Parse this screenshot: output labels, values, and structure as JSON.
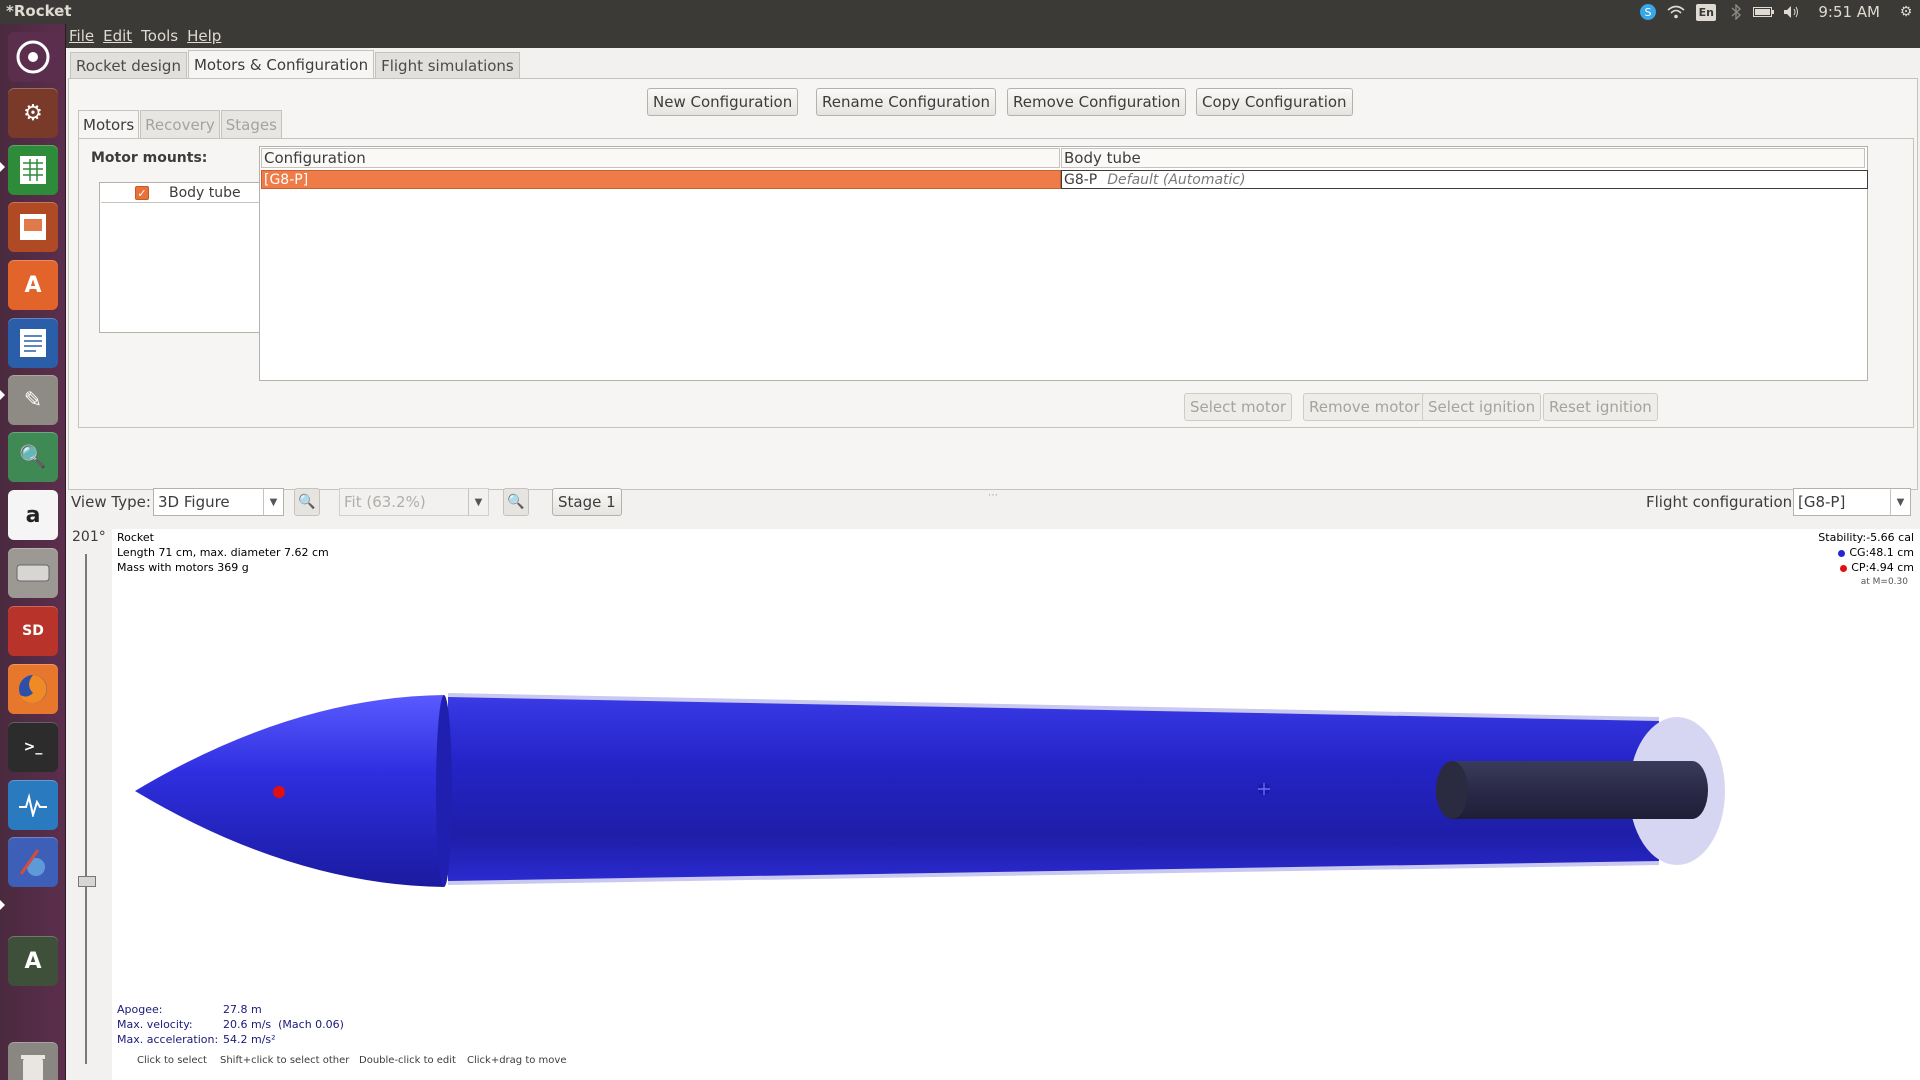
{
  "window": {
    "title": "*Rocket"
  },
  "tray": {
    "language": "En",
    "clock": "9:51 AM"
  },
  "menu": {
    "file": "File",
    "edit": "Edit",
    "tools": "Tools",
    "help": "Help"
  },
  "tabs": {
    "rocket_design": "Rocket design",
    "motors_config": "Motors & Configuration",
    "flight_sims": "Flight simulations"
  },
  "config_buttons": {
    "new": "New Configuration",
    "rename": "Rename Configuration",
    "remove": "Remove Configuration",
    "copy": "Copy Configuration"
  },
  "sub_tabs": {
    "motors": "Motors",
    "recovery": "Recovery",
    "stages": "Stages"
  },
  "motor_mounts": {
    "label": "Motor mounts:",
    "items": [
      {
        "name": "Body tube",
        "checked": true
      }
    ]
  },
  "table": {
    "headers": [
      "Configuration",
      "Body tube"
    ],
    "rows": [
      {
        "config": "[G8-P]",
        "motor": "G8-P",
        "delay": "Default (Automatic)"
      }
    ]
  },
  "motor_buttons": {
    "select_motor": "Select motor",
    "remove_motor": "Remove motor",
    "select_ignition": "Select ignition",
    "reset_ignition": "Reset ignition"
  },
  "view_toolbar": {
    "view_type_label": "View Type:",
    "view_type_value": "3D Figure",
    "zoom_value": "Fit (63.2%)",
    "stage_button": "Stage 1",
    "flight_config_label": "Flight configuration:",
    "flight_config_value": "[G8-P]"
  },
  "view": {
    "angle": "201°",
    "rocket_name": "Rocket",
    "dimensions": "Length 71 cm, max. diameter 7.62 cm",
    "mass": "Mass with motors 369 g",
    "stability": "Stability:-5.66 cal",
    "cg": "CG:48.1 cm",
    "cp": "CP:4.94 cm",
    "mach": "at M=0.30",
    "apogee_label": "Apogee:",
    "apogee_value": "27.8 m",
    "velocity_label": "Max. velocity:",
    "velocity_value": "20.6 m/s  (Mach 0.06)",
    "accel_label": "Max. acceleration:",
    "accel_value": "54.2 m/s²",
    "hints": [
      "Click to select",
      "Shift+click to select other",
      "Double-click to edit",
      "Click+drag to move"
    ]
  },
  "colors": {
    "selection": "#ee7b48",
    "rocket_body": "#2424d8",
    "launcher_bg": "#5c2e4d"
  },
  "launcher_icons": [
    "ubuntu-dash-icon",
    "system-settings-icon",
    "libreoffice-calc-icon",
    "libreoffice-impress-icon",
    "software-center-icon",
    "libreoffice-writer-icon",
    "text-editor-icon",
    "image-viewer-icon",
    "amazon-icon",
    "disk-drive-icon",
    "sd-card-icon",
    "firefox-icon",
    "terminal-icon",
    "system-monitor-icon",
    "openrocket-icon",
    "software-updater-icon",
    "trash-icon"
  ]
}
